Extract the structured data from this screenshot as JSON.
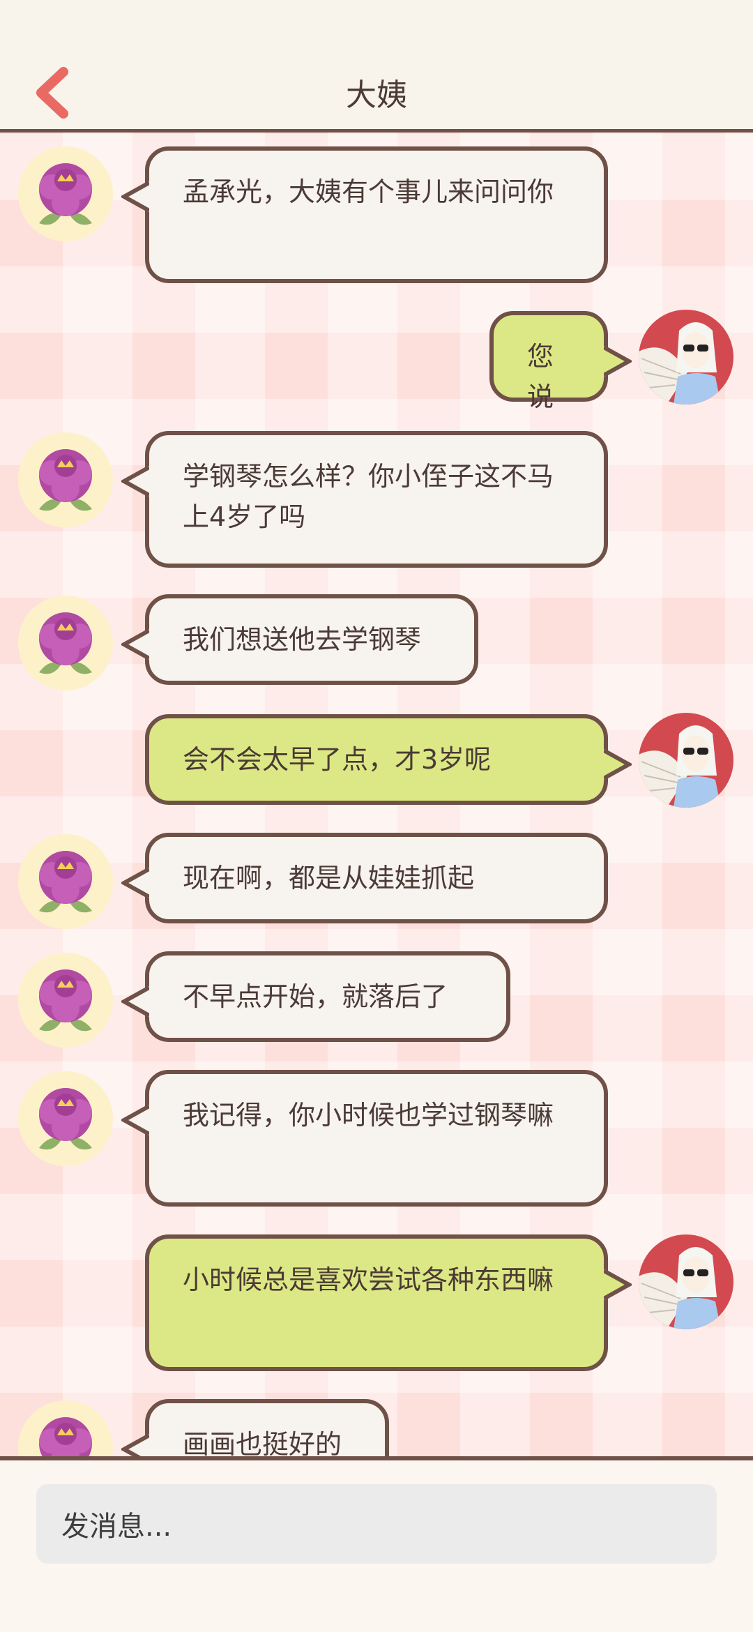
{
  "header": {
    "title": "大姨",
    "back_icon": "chevron-left-icon"
  },
  "colors": {
    "accent": "#e86a63",
    "border": "#6f5147",
    "aunt_bubble": "#f7f3ee",
    "me_bubble": "#dce885",
    "chat_bg": "#fde0dc"
  },
  "messages": [
    {
      "sender": "aunt",
      "text": "孟承光，大姨有个事儿来问问你"
    },
    {
      "sender": "me",
      "text": "您说"
    },
    {
      "sender": "aunt",
      "text": "学钢琴怎么样？你小侄子这不马上4岁了吗"
    },
    {
      "sender": "aunt",
      "text": "我们想送他去学钢琴"
    },
    {
      "sender": "me",
      "text": "会不会太早了点，才3岁呢"
    },
    {
      "sender": "aunt",
      "text": "现在啊，都是从娃娃抓起"
    },
    {
      "sender": "aunt",
      "text": "不早点开始，就落后了"
    },
    {
      "sender": "aunt",
      "text": "我记得，你小时候也学过钢琴嘛"
    },
    {
      "sender": "me",
      "text": "小时候总是喜欢尝试各种东西嘛"
    },
    {
      "sender": "aunt",
      "text": "画画也挺好的"
    }
  ],
  "input": {
    "placeholder": "发消息..."
  }
}
